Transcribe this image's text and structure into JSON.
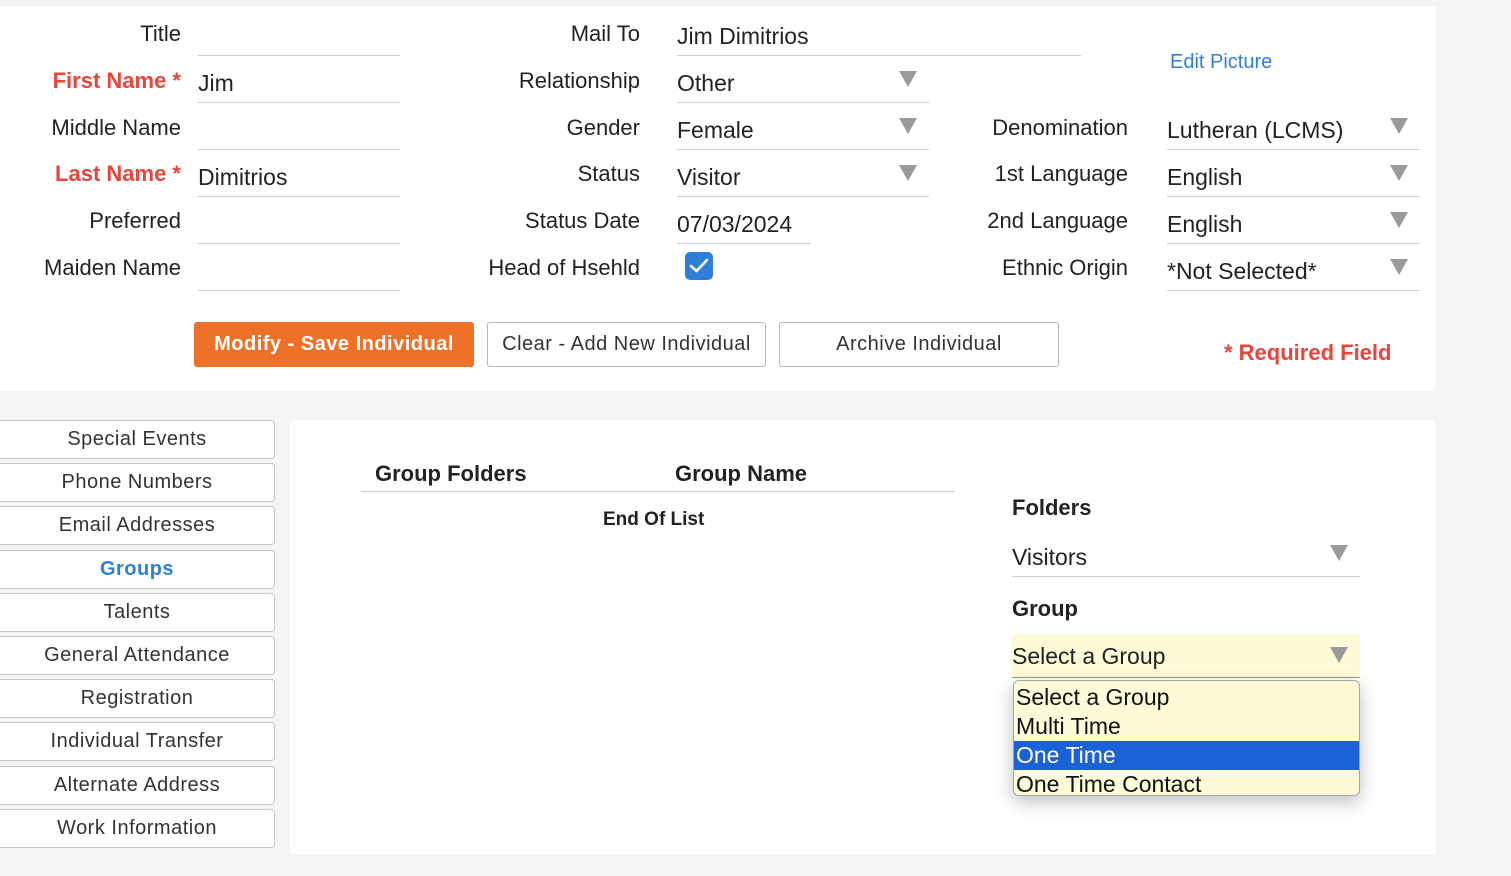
{
  "person": {
    "title_label": "Title",
    "title_value": "",
    "first_name_label": "First Name *",
    "first_name_value": "Jim",
    "middle_name_label": "Middle Name",
    "middle_name_value": "",
    "last_name_label": "Last Name *",
    "last_name_value": "Dimitrios",
    "preferred_label": "Preferred",
    "preferred_value": "",
    "maiden_name_label": "Maiden Name",
    "maiden_name_value": ""
  },
  "household": {
    "mail_to_label": "Mail To",
    "mail_to_value": "Jim Dimitrios",
    "relationship_label": "Relationship",
    "relationship_value": "Other",
    "gender_label": "Gender",
    "gender_value": "Female",
    "status_label": "Status",
    "status_value": "Visitor",
    "status_date_label": "Status Date",
    "status_date_value": "07/03/2024",
    "head_label": "Head of Hsehld",
    "head_checked": true
  },
  "profile": {
    "edit_picture": "Edit Picture",
    "denomination_label": "Denomination",
    "denomination_value": "Lutheran (LCMS)",
    "lang1_label": "1st Language",
    "lang1_value": "English",
    "lang2_label": "2nd Language",
    "lang2_value": "English",
    "ethnic_label": "Ethnic Origin",
    "ethnic_value": "*Not Selected*"
  },
  "actions": {
    "modify_save": "Modify - Save Individual",
    "clear_add": "Clear - Add New Individual",
    "archive": "Archive Individual",
    "required_note": "* Required Field"
  },
  "side_tabs": [
    {
      "label": "Special Events"
    },
    {
      "label": "Phone Numbers"
    },
    {
      "label": "Email Addresses"
    },
    {
      "label": "Groups",
      "active": true
    },
    {
      "label": "Talents"
    },
    {
      "label": "General Attendance"
    },
    {
      "label": "Registration"
    },
    {
      "label": "Individual Transfer"
    },
    {
      "label": "Alternate Address"
    },
    {
      "label": "Work Information"
    }
  ],
  "groups": {
    "col_folders": "Group Folders",
    "col_name": "Group Name",
    "end_of_list": "End Of List",
    "folders_title": "Folders",
    "folders_value": "Visitors",
    "group_title": "Group",
    "group_value": "Select a Group",
    "group_options": [
      "Select a Group",
      "Multi Time",
      "One Time",
      "One Time Contact"
    ],
    "group_highlighted": "One Time"
  },
  "colors": {
    "accent_orange": "#ef7027",
    "required_red": "#e8453c",
    "link_blue": "#2e7fd6",
    "select_highlight": "#1a62d6",
    "dropdown_bg": "#fdfbd8"
  }
}
